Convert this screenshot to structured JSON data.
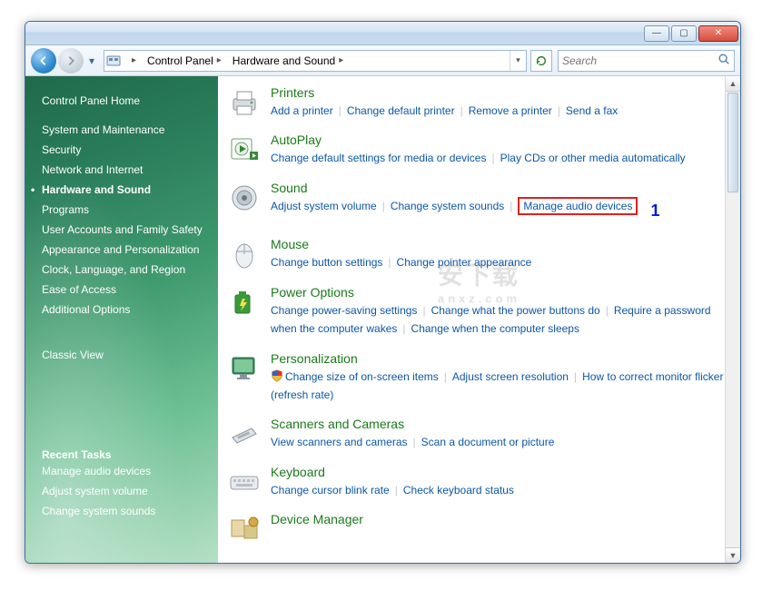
{
  "breadcrumb": {
    "root": "Control Panel",
    "current": "Hardware and Sound"
  },
  "search": {
    "placeholder": "Search"
  },
  "sidebar": {
    "home": "Control Panel Home",
    "items": [
      "System and Maintenance",
      "Security",
      "Network and Internet",
      "Hardware and Sound",
      "Programs",
      "User Accounts and Family Safety",
      "Appearance and Personalization",
      "Clock, Language, and Region",
      "Ease of Access",
      "Additional Options"
    ],
    "active_index": 3,
    "classic": "Classic View",
    "recent_header": "Recent Tasks",
    "recent": [
      "Manage audio devices",
      "Adjust system volume",
      "Change system sounds"
    ]
  },
  "annotation": {
    "label": "1"
  },
  "categories": [
    {
      "id": "printers",
      "title": "Printers",
      "tasks": [
        "Add a printer",
        "Change default printer",
        "Remove a printer",
        "Send a fax"
      ]
    },
    {
      "id": "autoplay",
      "title": "AutoPlay",
      "tasks": [
        "Change default settings for media or devices",
        "Play CDs or other media automatically"
      ]
    },
    {
      "id": "sound",
      "title": "Sound",
      "tasks": [
        "Adjust system volume",
        "Change system sounds",
        "Manage audio devices"
      ],
      "highlight_index": 2
    },
    {
      "id": "mouse",
      "title": "Mouse",
      "tasks": [
        "Change button settings",
        "Change pointer appearance"
      ]
    },
    {
      "id": "power",
      "title": "Power Options",
      "tasks": [
        "Change power-saving settings",
        "Change what the power buttons do",
        "Require a password when the computer wakes",
        "Change when the computer sleeps"
      ]
    },
    {
      "id": "personalization",
      "title": "Personalization",
      "tasks": [
        "Change size of on-screen items",
        "Adjust screen resolution",
        "How to correct monitor flicker (refresh rate)"
      ],
      "shield_index": 0
    },
    {
      "id": "scanners",
      "title": "Scanners and Cameras",
      "tasks": [
        "View scanners and cameras",
        "Scan a document or picture"
      ]
    },
    {
      "id": "keyboard",
      "title": "Keyboard",
      "tasks": [
        "Change cursor blink rate",
        "Check keyboard status"
      ]
    },
    {
      "id": "devicemgr",
      "title": "Device Manager",
      "tasks": []
    }
  ],
  "watermark": {
    "main": "安下载",
    "sub": "anxz.com"
  }
}
